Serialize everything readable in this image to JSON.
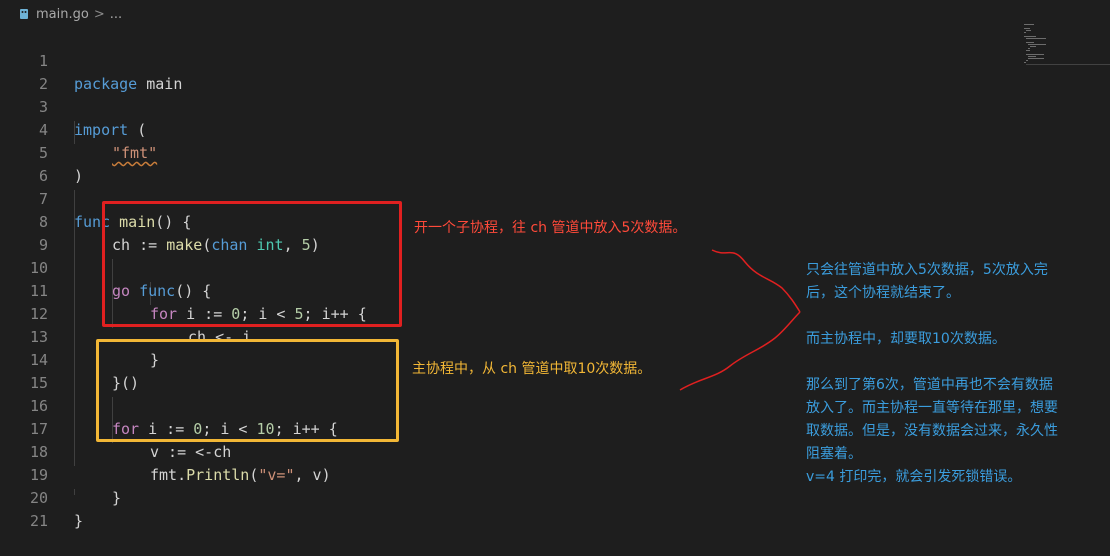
{
  "breadcrumb": {
    "file": "main.go",
    "separator": ">",
    "ellipsis": "..."
  },
  "colors": {
    "background": "#1e1e1e",
    "keyword": "#569cd6",
    "control": "#c586c0",
    "function": "#dcdcaa",
    "string": "#ce9178",
    "number": "#b5cea8",
    "type": "#4ec9b0",
    "annotation_red": "#ff4a3a",
    "annotation_yellow": "#f2b736",
    "annotation_blue": "#3b9ddd"
  },
  "code": {
    "lines": [
      {
        "num": "1"
      },
      {
        "num": "2"
      },
      {
        "num": "3"
      },
      {
        "num": "4"
      },
      {
        "num": "5"
      },
      {
        "num": "6"
      },
      {
        "num": "7"
      },
      {
        "num": "8"
      },
      {
        "num": "9"
      },
      {
        "num": "10"
      },
      {
        "num": "11"
      },
      {
        "num": "12"
      },
      {
        "num": "13"
      },
      {
        "num": "14"
      },
      {
        "num": "15"
      },
      {
        "num": "16"
      },
      {
        "num": "17"
      },
      {
        "num": "18"
      },
      {
        "num": "19"
      },
      {
        "num": "20"
      },
      {
        "num": "21"
      }
    ],
    "tokens": {
      "package": "package",
      "main": "main",
      "import": "import",
      "lparen": "(",
      "fmt_str": "\"fmt\"",
      "rparen": ")",
      "func": "func",
      "main_fn": "main",
      "fn_sig": "() {",
      "ch": "ch",
      "assign": " := ",
      "make": "make",
      "lp": "(",
      "chan": "chan",
      "sp": " ",
      "int": "int",
      "comma": ", ",
      "five": "5",
      "rp": ")",
      "go": "go",
      "func2": "func",
      "fn_open": "() {",
      "for": "for",
      "i_decl": " i := ",
      "zero": "0",
      "cond_a": "; i < ",
      "cond_b": "; i++ {",
      "send": "ch <- i",
      "close_brace": "}",
      "call_close": "}()",
      "ten": "10",
      "recv": "v := <-ch",
      "fmt_pkg": "fmt.",
      "println": "Println",
      "v_str": "\"v=\"",
      "println_args": ", v)"
    }
  },
  "annotations": {
    "red_note": "开一个子协程，往 ch 管道中放入5次数据。",
    "yellow_note": "主协程中，从 ch 管道中取10次数据。",
    "blue_note": [
      "只会往管道中放入5次数据，5次放入完",
      "后，这个协程就结束了。",
      "",
      "而主协程中，却要取10次数据。",
      "",
      "那么到了第6次，管道中再也不会有数据",
      "放入了。而主协程一直等待在那里，想要",
      "取数据。但是，没有数据会过来，永久性",
      "阻塞着。",
      "v=4 打印完，就会引发死锁错误。"
    ]
  }
}
